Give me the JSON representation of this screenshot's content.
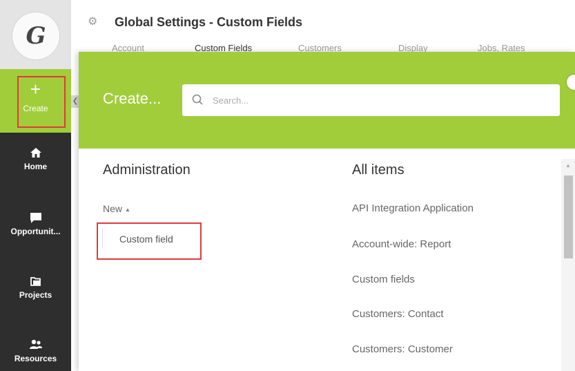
{
  "sidebar": {
    "logo_letter": "G",
    "create": {
      "icon": "plus-icon",
      "label": "Create"
    },
    "items": [
      {
        "id": "home",
        "icon": "home-icon",
        "label": "Home"
      },
      {
        "id": "opportunities",
        "icon": "chat-bubble-icon",
        "label": "Opportunit..."
      },
      {
        "id": "projects",
        "icon": "projects-folder-icon",
        "label": "Projects"
      },
      {
        "id": "resources",
        "icon": "people-icon",
        "label": "Resources"
      }
    ]
  },
  "header": {
    "title": "Global Settings - Custom Fields",
    "tabs": [
      "Account",
      "Custom Fields",
      "Customers",
      "Display",
      "Jobs, Rates"
    ]
  },
  "modal": {
    "title": "Create...",
    "search_placeholder": "Search...",
    "administration": {
      "heading": "Administration",
      "new_label": "New",
      "option": "Custom field"
    },
    "all_items": {
      "heading": "All items",
      "items": [
        "API Integration Application",
        "Account-wide: Report",
        "Custom fields",
        "Customers: Contact",
        "Customers: Customer"
      ]
    }
  },
  "colors": {
    "brand_green": "#a1cd3a",
    "sidebar_dark": "#2e2e2e",
    "highlight_red": "#e0393c"
  }
}
